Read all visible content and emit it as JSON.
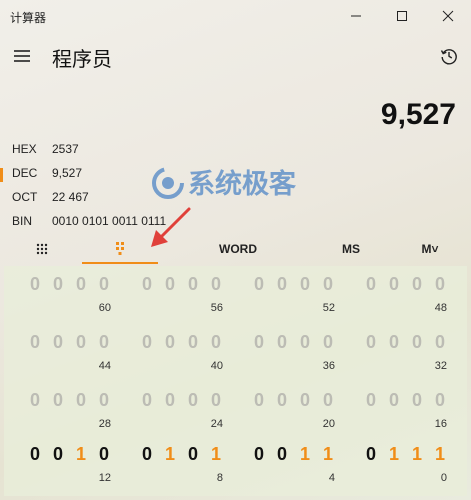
{
  "app": {
    "title": "计算器"
  },
  "window_controls": [
    "minimize-icon",
    "maximize-icon",
    "close-icon"
  ],
  "header": {
    "mode_title": "程序员",
    "menu_icon": "hamburger-icon",
    "history_icon": "history-icon"
  },
  "display": {
    "value": "9,527"
  },
  "bases": [
    {
      "label": "HEX",
      "value": "2537",
      "selected": false
    },
    {
      "label": "DEC",
      "value": "9,527",
      "selected": true
    },
    {
      "label": "OCT",
      "value": "22 467",
      "selected": false
    },
    {
      "label": "BIN",
      "value": "0010 0101 0011 0111",
      "selected": false
    }
  ],
  "watermark": {
    "text": "系统极客"
  },
  "tabs": [
    {
      "id": "keypad",
      "icon": "keypad-icon",
      "label": ""
    },
    {
      "id": "bit-toggle",
      "icon": "bit-toggle-icon",
      "label": "",
      "active": true
    },
    {
      "id": "word",
      "label": "WORD"
    },
    {
      "id": "ms",
      "label": "MS"
    },
    {
      "id": "memory-list",
      "label": "M˅"
    }
  ],
  "bit_rows": [
    {
      "bits": [
        "0",
        "0",
        "0",
        "0",
        "0",
        "0",
        "0",
        "0",
        "0",
        "0",
        "0",
        "0",
        "0",
        "0",
        "0",
        "0"
      ],
      "labels": [
        "60",
        "56",
        "52",
        "48"
      ]
    },
    {
      "bits": [
        "0",
        "0",
        "0",
        "0",
        "0",
        "0",
        "0",
        "0",
        "0",
        "0",
        "0",
        "0",
        "0",
        "0",
        "0",
        "0"
      ],
      "labels": [
        "44",
        "40",
        "36",
        "32"
      ]
    },
    {
      "bits": [
        "0",
        "0",
        "0",
        "0",
        "0",
        "0",
        "0",
        "0",
        "0",
        "0",
        "0",
        "0",
        "0",
        "0",
        "0",
        "0"
      ],
      "labels": [
        "28",
        "24",
        "20",
        "16"
      ]
    },
    {
      "bits": [
        "0",
        "0",
        "1",
        "0",
        "0",
        "1",
        "0",
        "1",
        "0",
        "0",
        "1",
        "1",
        "0",
        "1",
        "1",
        "1"
      ],
      "labels": [
        "12",
        "8",
        "4",
        "0"
      ],
      "active": true
    }
  ],
  "colors": {
    "accent": "#f08d18",
    "inactive_bit": "#bcbcb4",
    "text": "#111111",
    "arrow": "#e0403a",
    "watermark": "#4f86c6"
  }
}
